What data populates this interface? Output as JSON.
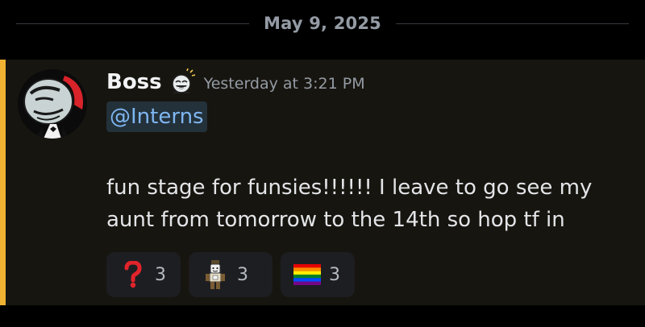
{
  "date_divider": {
    "label": "May 9, 2025"
  },
  "message": {
    "author": "Boss",
    "timestamp": "Yesterday at 3:21 PM",
    "mention": "@Interns",
    "content": "fun stage for funsies!!!!!! I leave to go see my aunt from tomorrow to the 14th so hop tf in",
    "highlight_color": "#f0b232",
    "reactions": [
      {
        "emoji": "red-question-mark",
        "count": "3"
      },
      {
        "emoji": "roblox-character",
        "count": "3"
      },
      {
        "emoji": "rainbow-flag",
        "count": "3"
      }
    ]
  }
}
